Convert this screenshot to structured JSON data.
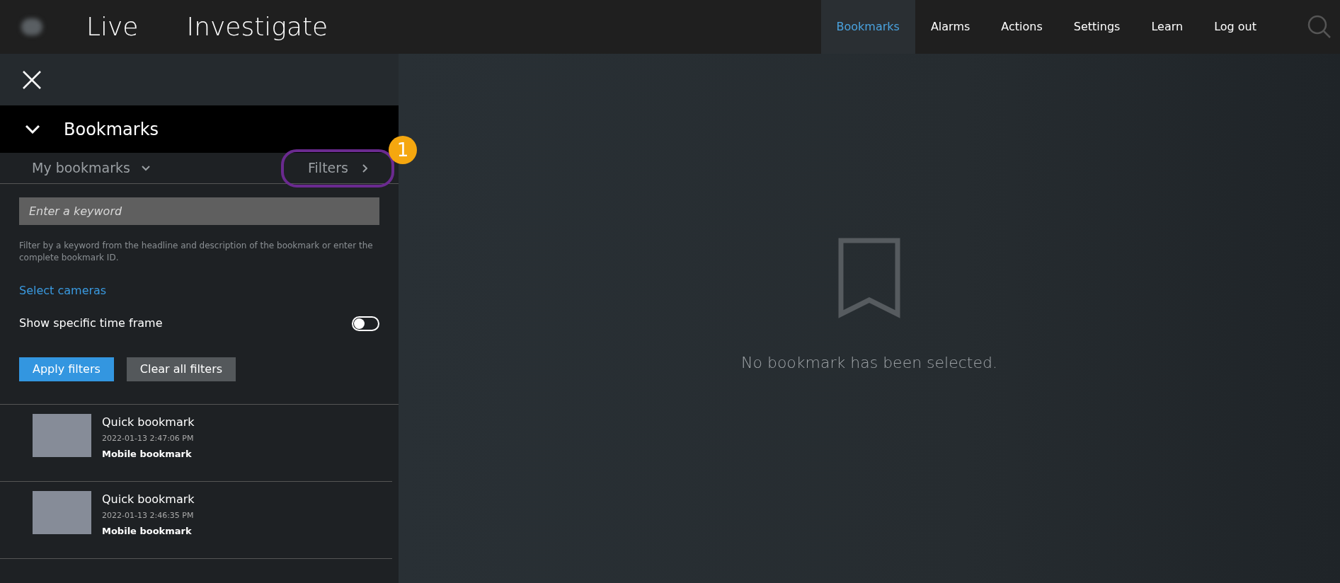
{
  "top_bar": {
    "modes": [
      {
        "label": "Live",
        "selected": false
      },
      {
        "label": "Investigate",
        "selected": false
      }
    ],
    "nav": [
      {
        "label": "Bookmarks",
        "selected": true
      },
      {
        "label": "Alarms",
        "selected": false
      },
      {
        "label": "Actions",
        "selected": false
      },
      {
        "label": "Settings",
        "selected": false
      },
      {
        "label": "Learn",
        "selected": false
      },
      {
        "label": "Log out",
        "selected": false
      }
    ]
  },
  "panel": {
    "title": "Bookmarks",
    "expanded": true,
    "scope": "My bookmarks",
    "filters_link": "Filters",
    "callout": "1",
    "search": {
      "placeholder": "Enter a keyword"
    },
    "help": "Filter by a keyword from the headline and description of the bookmark or enter the complete bookmark ID.",
    "select_cameras": "Select cameras",
    "time_frame": {
      "label": "Show specific time frame",
      "on": false
    },
    "buttons": [
      {
        "label": "Apply filters",
        "kind": "primary"
      },
      {
        "label": "Clear all filters",
        "kind": "secondary"
      }
    ],
    "bookmarks": [
      {
        "title": "Quick bookmark",
        "time": "2022-01-13 2:47:06 PM",
        "description": "Mobile bookmark"
      },
      {
        "title": "Quick bookmark",
        "time": "2022-01-13 2:46:35 PM",
        "description": "Mobile bookmark"
      }
    ]
  },
  "empty_state": {
    "message": "No bookmark has been selected."
  }
}
